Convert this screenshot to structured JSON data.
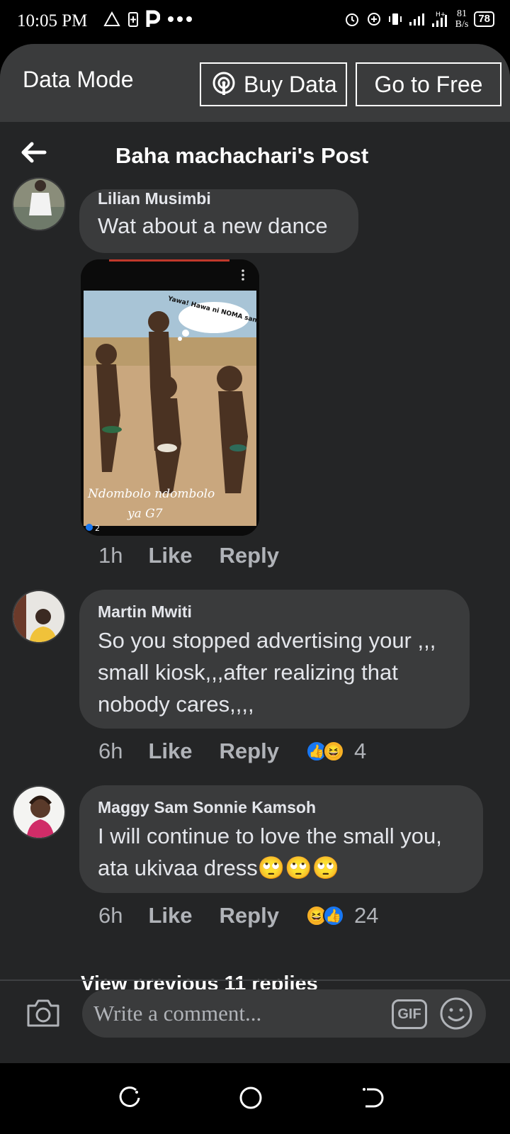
{
  "status_bar": {
    "time": "10:05 PM",
    "speed_value": "81",
    "speed_unit": "B/s",
    "battery": "78"
  },
  "data_bar": {
    "label": "Data Mode",
    "buy_label": "Buy Data",
    "free_label": "Go to Free"
  },
  "header": {
    "title": "Baha machachari's Post"
  },
  "comments": [
    {
      "author": "Lilian Musimbi",
      "text": "Wat about a new dance",
      "time": "1h",
      "like": "Like",
      "reply": "Reply"
    },
    {
      "author": "Martin Mwiti",
      "text": "So you stopped advertising your ,,, small kiosk,,,after realizing that nobody cares,,,,",
      "time": "6h",
      "like": "Like",
      "reply": "Reply",
      "reaction_count": "4"
    },
    {
      "author": "Maggy Sam Sonnie Kamsoh",
      "text": "I will continue to love the small you, ata ukivaa dress🙄🙄🙄",
      "time": "6h",
      "like": "Like",
      "reply": "Reply",
      "reaction_count": "24"
    }
  ],
  "meme": {
    "bubble_text": "Yawa! Hawa ni NOMA sana.",
    "caption_line1": "Ndombolo ndombolo",
    "caption_line2": "ya G7",
    "corner_count": "2"
  },
  "view_previous": "View previous 11 replies",
  "composer": {
    "placeholder": "Write a comment...",
    "gif_label": "GIF"
  }
}
